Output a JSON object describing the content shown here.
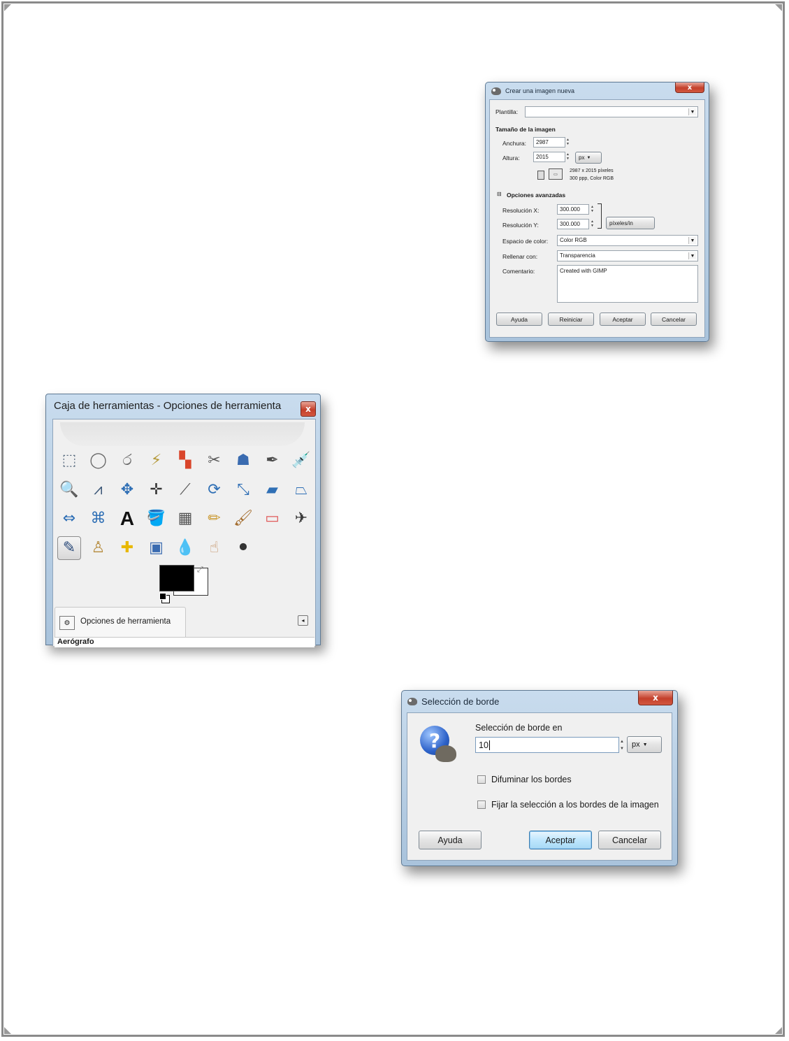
{
  "new_image_dialog": {
    "title": "Crear una imagen nueva",
    "close": "x",
    "template_label": "Plantilla:",
    "template_value": "",
    "size_heading": "Tamaño de la imagen",
    "width_label": "Anchura:",
    "width_value": "2987",
    "height_label": "Altura:",
    "height_value": "2015",
    "unit": "px",
    "info_line1": "2987 x 2015 píxeles",
    "info_line2": "300 ppp, Color RGB",
    "advanced_toggle": "⊟",
    "advanced_heading": "Opciones avanzadas",
    "res_x_label": "Resolución X:",
    "res_x_value": "300.000",
    "res_y_label": "Resolución Y:",
    "res_y_value": "300.000",
    "res_unit": "píxeles/in",
    "colorspace_label": "Espacio de color:",
    "colorspace_value": "Color RGB",
    "fill_label": "Rellenar con:",
    "fill_value": "Transparencia",
    "comment_label": "Comentario:",
    "comment_value": "Created with GIMP",
    "buttons": {
      "help": "Ayuda",
      "reset": "Reiniciar",
      "ok": "Aceptar",
      "cancel": "Cancelar"
    }
  },
  "toolbox": {
    "title": "Caja de herramientas - Opciones de herramienta",
    "close": "x",
    "tools": [
      {
        "name": "rect-select-icon",
        "glyph": "⬚"
      },
      {
        "name": "ellipse-select-icon",
        "glyph": "◯"
      },
      {
        "name": "free-select-icon",
        "glyph": "ර"
      },
      {
        "name": "fuzzy-select-icon",
        "glyph": "⚡"
      },
      {
        "name": "color-select-icon",
        "glyph": "▚"
      },
      {
        "name": "scissors-icon",
        "glyph": "✂"
      },
      {
        "name": "foreground-select-icon",
        "glyph": "☗"
      },
      {
        "name": "paths-icon",
        "glyph": "✒"
      },
      {
        "name": "color-picker-icon",
        "glyph": "💉"
      },
      {
        "name": "zoom-icon",
        "glyph": "🔍"
      },
      {
        "name": "measure-icon",
        "glyph": "⩘"
      },
      {
        "name": "move-icon",
        "glyph": "✥"
      },
      {
        "name": "align-icon",
        "glyph": "✛"
      },
      {
        "name": "crop-icon",
        "glyph": "⟋"
      },
      {
        "name": "rotate-icon",
        "glyph": "⟳"
      },
      {
        "name": "scale-icon",
        "glyph": "⤡"
      },
      {
        "name": "shear-icon",
        "glyph": "▰"
      },
      {
        "name": "perspective-icon",
        "glyph": "⏢"
      },
      {
        "name": "flip-icon",
        "glyph": "⇔"
      },
      {
        "name": "cage-icon",
        "glyph": "⌘"
      },
      {
        "name": "text-icon",
        "glyph": "A"
      },
      {
        "name": "bucket-fill-icon",
        "glyph": "🪣"
      },
      {
        "name": "blend-icon",
        "glyph": "▦"
      },
      {
        "name": "pencil-icon",
        "glyph": "✏"
      },
      {
        "name": "paintbrush-icon",
        "glyph": "🖌"
      },
      {
        "name": "eraser-icon",
        "glyph": "▭"
      },
      {
        "name": "airbrush-icon",
        "glyph": "✈"
      },
      {
        "name": "ink-icon",
        "glyph": "✎"
      },
      {
        "name": "clone-icon",
        "glyph": "♙"
      },
      {
        "name": "heal-icon",
        "glyph": "✚"
      },
      {
        "name": "perspective-clone-icon",
        "glyph": "▣"
      },
      {
        "name": "blur-icon",
        "glyph": "💧"
      },
      {
        "name": "smudge-icon",
        "glyph": "☝"
      },
      {
        "name": "dodge-burn-icon",
        "glyph": "⚫"
      }
    ],
    "tab_label": "Opciones de herramienta",
    "options_heading": "Aerógrafo"
  },
  "border_dialog": {
    "title": "Selección de borde",
    "close": "x",
    "prompt": "Selección de borde en",
    "value": "10",
    "unit": "px",
    "feather_label": "Difuminar los bordes",
    "lock_label": "Fijar la selección a los bordes de la imagen",
    "buttons": {
      "help": "Ayuda",
      "ok": "Aceptar",
      "cancel": "Cancelar"
    }
  }
}
